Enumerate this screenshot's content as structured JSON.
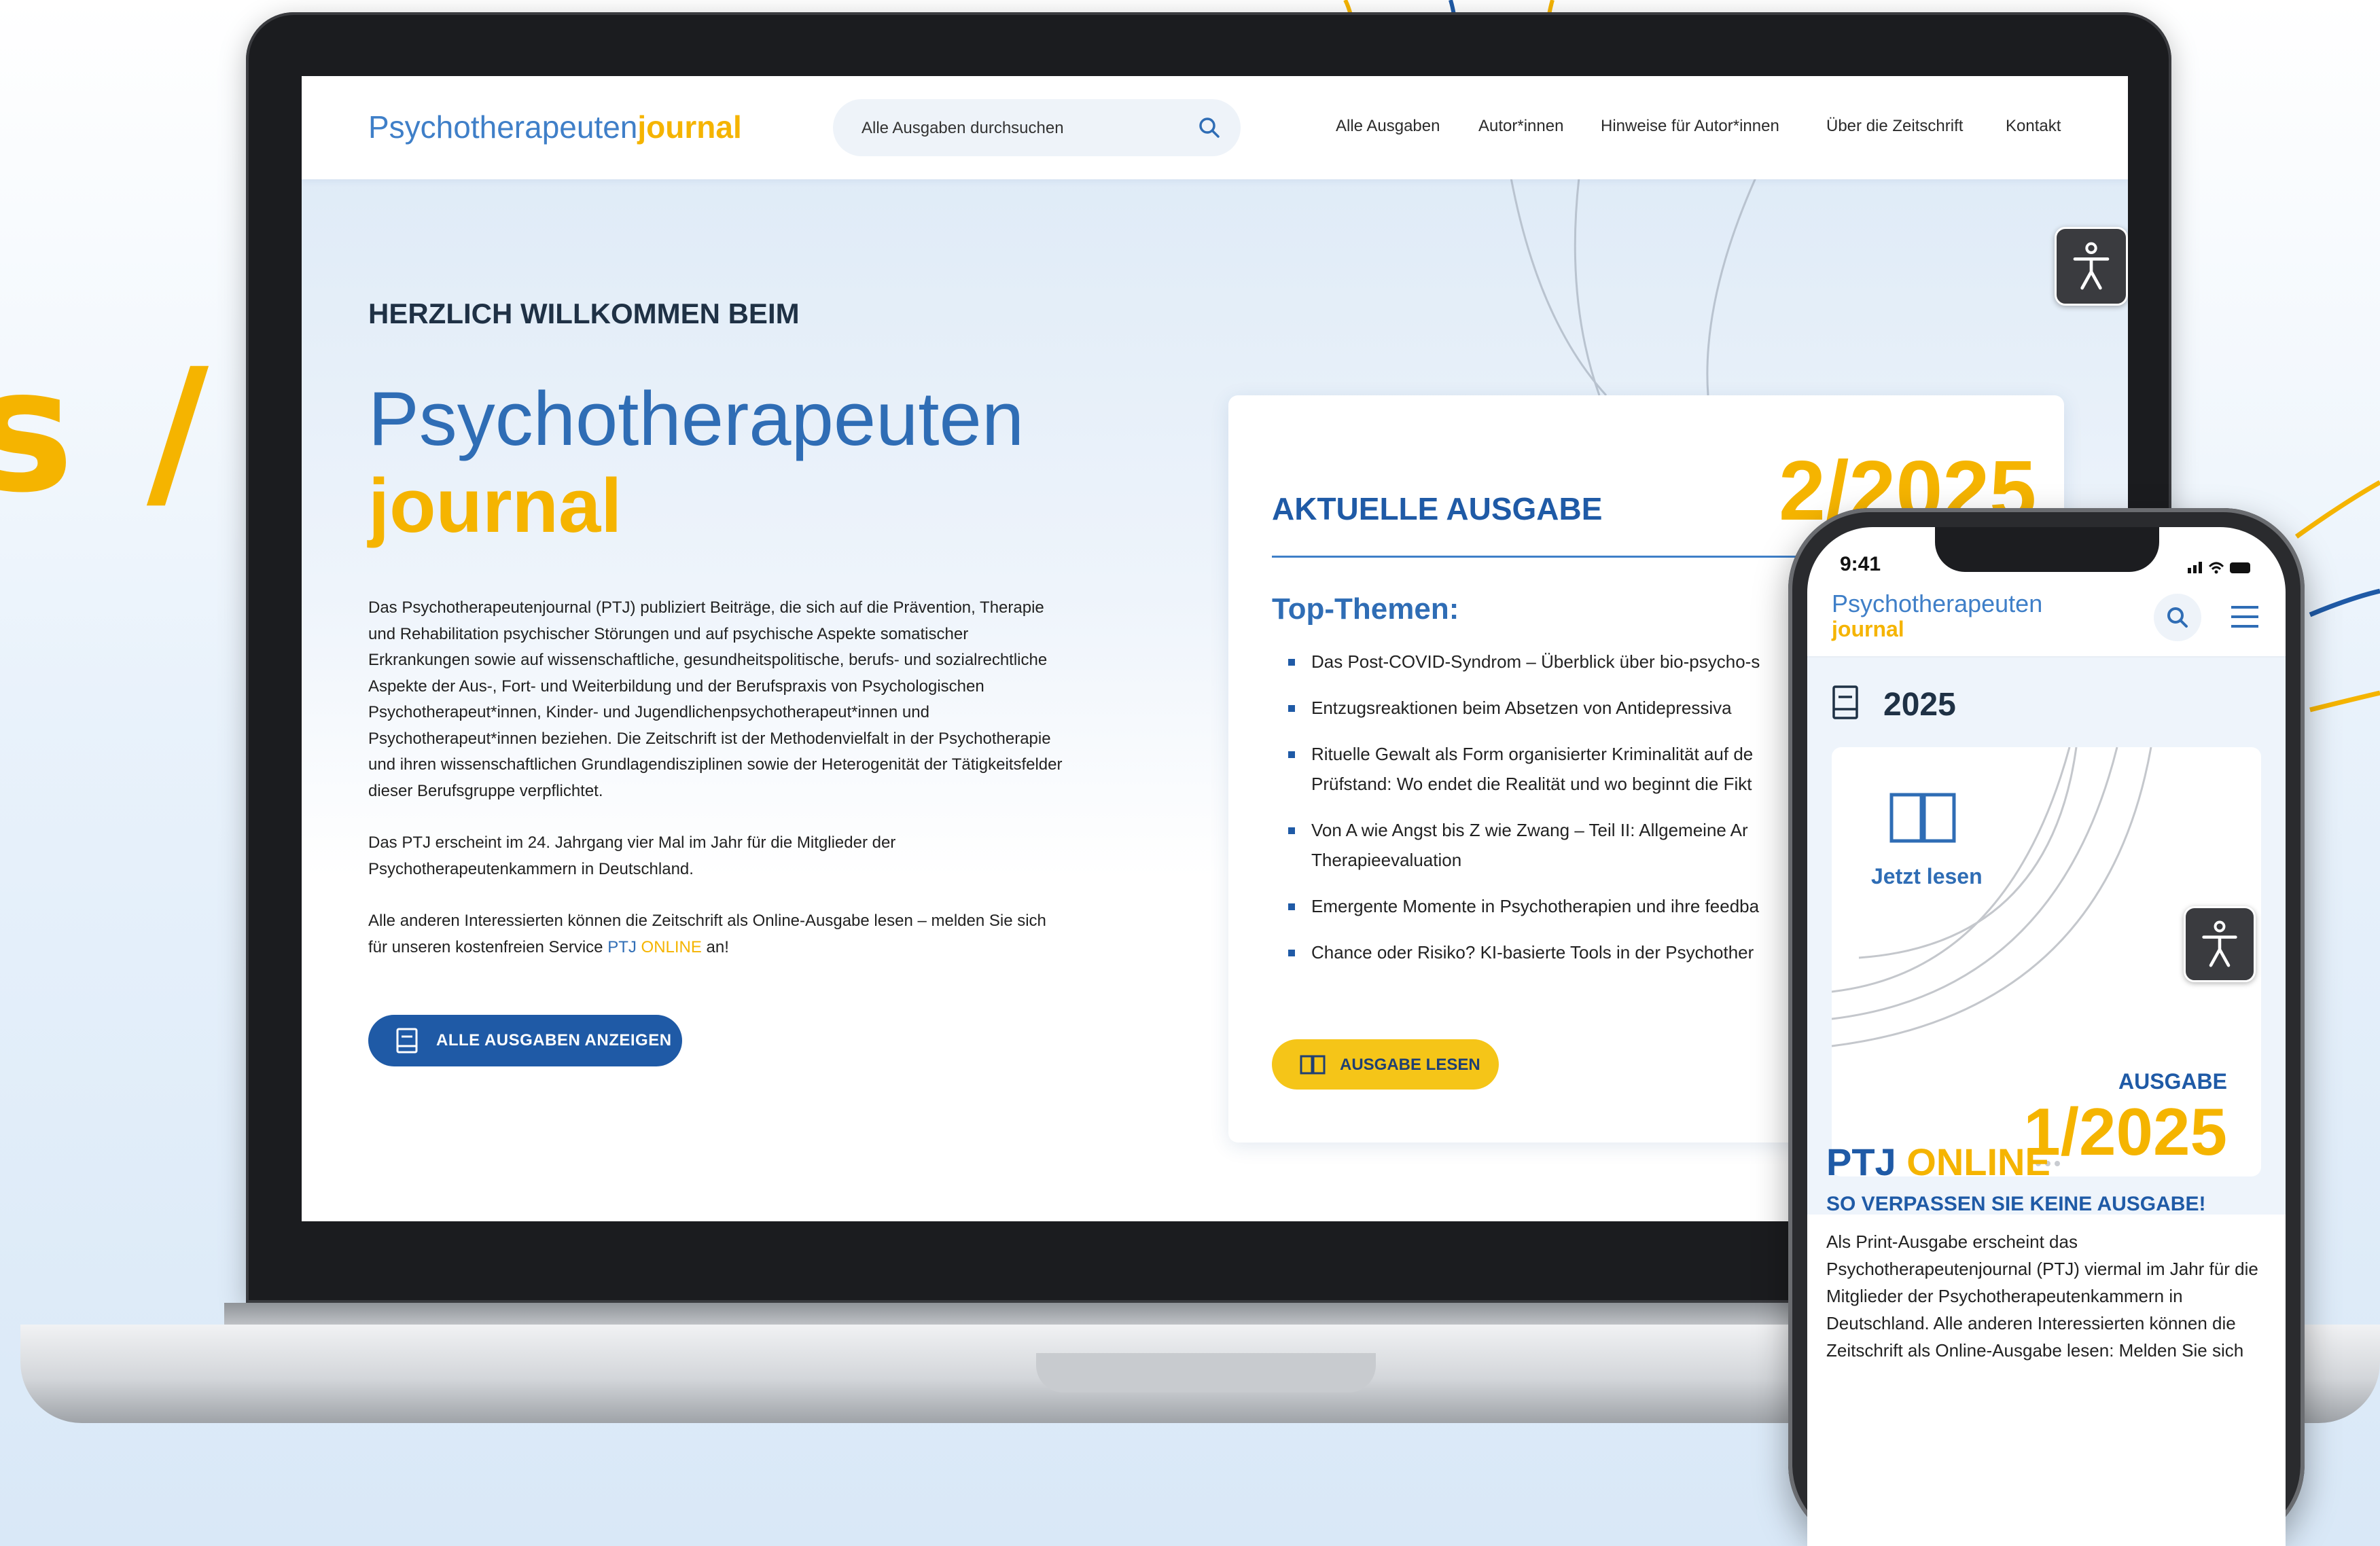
{
  "background": {
    "glyph": "s /"
  },
  "site": {
    "logo": {
      "main": "Psychotherapeuten",
      "accent": "journal"
    },
    "search": {
      "placeholder": "Alle Ausgaben durchsuchen"
    },
    "nav": [
      "Alle Ausgaben",
      "Autor*innen",
      "Hinweise für Autor*innen",
      "Über die Zeitschrift",
      "Kontakt"
    ]
  },
  "hero": {
    "kicker": "HERZLICH WILLKOMMEN BEIM",
    "title_main": "Psychotherapeuten",
    "title_accent": "journal",
    "paragraphs": [
      "Das Psychotherapeutenjournal (PTJ) publiziert Beiträge, die sich auf die Prävention, Therapie und Rehabilitation psychischer Störungen und auf psychische Aspekte somatischer Erkrankungen sowie auf wissenschaftliche, gesundheitspolitische, berufs- und sozialrechtliche Aspekte der Aus-, Fort- und Weiterbildung und der Berufspraxis von Psychologischen Psychotherapeut*innen, Kinder- und Jugendlichenpsychotherapeut*innen und Psychotherapeut*innen beziehen. Die Zeitschrift ist der Methodenvielfalt in der Psychotherapie und ihren wissenschaftlichen Grundlagendisziplinen sowie der Heterogenität der Tätigkeitsfelder dieser Berufsgruppe verpflichtet.",
      "Das PTJ erscheint im 24. Jahrgang vier Mal im Jahr für die Mitglieder der Psychotherapeutenkammern in Deutschland."
    ],
    "paragraph3": {
      "before": "Alle anderen Interessierten können die Zeitschrift als Online-Ausgabe lesen – melden Sie sich für unseren kostenfreien Service ",
      "ptj": "PTJ",
      "online": "ONLINE",
      "after": " an!"
    },
    "button_label": "ALLE AUSGABEN ANZEIGEN"
  },
  "issue_card": {
    "heading": "AKTUELLE AUSGABE",
    "issue": "2/2025",
    "topics_title": "Top-Themen:",
    "topics": [
      "Das Post-COVID-Syndrom – Überblick über bio-psycho-s",
      "Entzugsreaktionen beim Absetzen von Antidepressiva",
      "Rituelle Gewalt als Form organisierter Kriminalität auf de Prüfstand: Wo endet die Realität und wo beginnt die Fikt",
      "Von A wie Angst bis Z wie Zwang – Teil II: Allgemeine Ar Therapieevaluation",
      "Emergente Momente in Psychotherapien und ihre feedba",
      "Chance oder Risiko? KI-basierte Tools in der Psychother"
    ],
    "button_label": "AUSGABE LESEN"
  },
  "phone": {
    "time": "9:41",
    "logo_main": "Psychotherapeuten",
    "logo_accent": "journal",
    "year": "2025",
    "read_label": "Jetzt lesen",
    "issue_label": "AUSGABE",
    "issue": "1/2025",
    "ptj": "PTJ",
    "online": "ONLINE",
    "subheading": "SO VERPASSEN SIE KEINE AUSGABE!",
    "text": "Als Print-Ausgabe erscheint das Psychotherapeutenjournal (PTJ) viermal im Jahr für die Mitglieder der Psychotherapeutenkammern in Deutschland. Alle anderen Interessierten können die Zeitschrift als Online-Ausgabe lesen: Melden Sie sich"
  },
  "colors": {
    "brand_blue": "#1f5aa6",
    "accent_yellow": "#f5b400",
    "light_blue": "#3f7fc8"
  }
}
